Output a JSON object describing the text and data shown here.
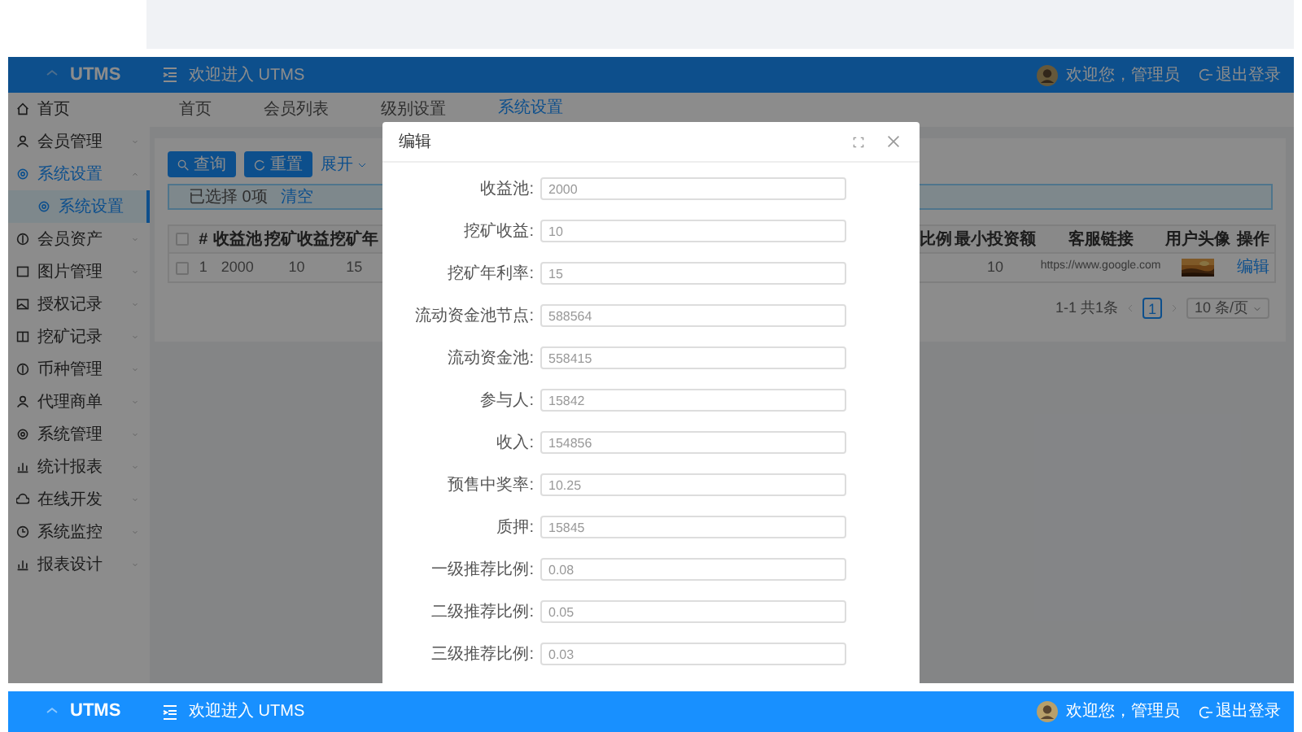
{
  "header": {
    "logo": "UTMS",
    "welcome": "欢迎进入 UTMS",
    "user": "欢迎您，管理员",
    "logout": "退出登录"
  },
  "sidebar": {
    "items": [
      {
        "label": "首页",
        "kind": "link",
        "selected": false
      },
      {
        "label": "会员管理",
        "kind": "group",
        "selected": false,
        "expanded": false
      },
      {
        "label": "系统设置",
        "kind": "group",
        "selected": true,
        "expanded": true,
        "children": [
          {
            "label": "系统设置",
            "selected": true
          }
        ]
      },
      {
        "label": "会员资产",
        "kind": "group",
        "selected": false,
        "expanded": false
      },
      {
        "label": "图片管理",
        "kind": "group",
        "selected": false,
        "expanded": false
      },
      {
        "label": "授权记录",
        "kind": "group",
        "selected": false,
        "expanded": false
      },
      {
        "label": "挖矿记录",
        "kind": "group",
        "selected": false,
        "expanded": false
      },
      {
        "label": "币种管理",
        "kind": "group",
        "selected": false,
        "expanded": false
      },
      {
        "label": "代理商单",
        "kind": "group",
        "selected": false,
        "expanded": false
      },
      {
        "label": "系统管理",
        "kind": "group",
        "selected": false,
        "expanded": false
      },
      {
        "label": "统计报表",
        "kind": "group",
        "selected": false,
        "expanded": false
      },
      {
        "label": "在线开发",
        "kind": "group",
        "selected": false,
        "expanded": false
      },
      {
        "label": "系统监控",
        "kind": "group",
        "selected": false,
        "expanded": false
      },
      {
        "label": "报表设计",
        "kind": "group",
        "selected": false,
        "expanded": false
      }
    ]
  },
  "tabs": [
    {
      "label": "首页",
      "selected": false
    },
    {
      "label": "会员列表",
      "selected": false
    },
    {
      "label": "级别设置",
      "selected": false
    },
    {
      "label": "系统设置",
      "selected": true
    }
  ],
  "toolbar": {
    "buttons": [
      {
        "label": "查询",
        "kind": "search"
      },
      {
        "label": "重置",
        "kind": "reset"
      }
    ],
    "expand": "展开"
  },
  "selection_alert": {
    "text": "已选择 0项",
    "link": "清空"
  },
  "table": {
    "header_checked": false,
    "columns": [
      "#",
      "收益池",
      "挖矿收益",
      "挖矿年",
      "",
      "比例",
      "最小投资额",
      "客服链接",
      "用户头像",
      "操作"
    ],
    "rows": [
      {
        "checked": false,
        "cells": [
          {
            "kind": "text",
            "text": "1"
          },
          {
            "kind": "text",
            "text": "2000"
          },
          {
            "kind": "text",
            "text": "10"
          },
          {
            "kind": "text",
            "text": "15"
          },
          {
            "kind": "covered"
          },
          {
            "kind": "covered"
          },
          {
            "kind": "text",
            "text": "10"
          },
          {
            "kind": "text",
            "text": "https://www.google.com"
          },
          {
            "kind": "picture"
          },
          {
            "kind": "link",
            "text": "编辑"
          }
        ]
      }
    ]
  },
  "pagination": {
    "summary": "1-1 共1条",
    "pages": [
      {
        "label": "1",
        "selected": true
      }
    ],
    "page_size": "10 条/页"
  },
  "modal": {
    "title": "编辑",
    "fields": [
      {
        "label": "收益池:",
        "value": "2000"
      },
      {
        "label": "挖矿收益:",
        "value": "10"
      },
      {
        "label": "挖矿年利率:",
        "value": "15"
      },
      {
        "label": "流动资金池节点:",
        "value": "588564"
      },
      {
        "label": "流动资金池:",
        "value": "558415"
      },
      {
        "label": "参与人:",
        "value": "15842"
      },
      {
        "label": "收入:",
        "value": "154856"
      },
      {
        "label": "预售中奖率:",
        "value": "10.25"
      },
      {
        "label": "质押:",
        "value": "15845"
      },
      {
        "label": "一级推荐比例:",
        "value": "0.08"
      },
      {
        "label": "二级推荐比例:",
        "value": "0.05"
      },
      {
        "label": "三级推荐比例:",
        "value": "0.03"
      }
    ]
  },
  "bottom_header": {
    "logo": "UTMS",
    "welcome": "欢迎进入 UTMS",
    "user": "欢迎您，管理员",
    "logout": "退出登录"
  }
}
